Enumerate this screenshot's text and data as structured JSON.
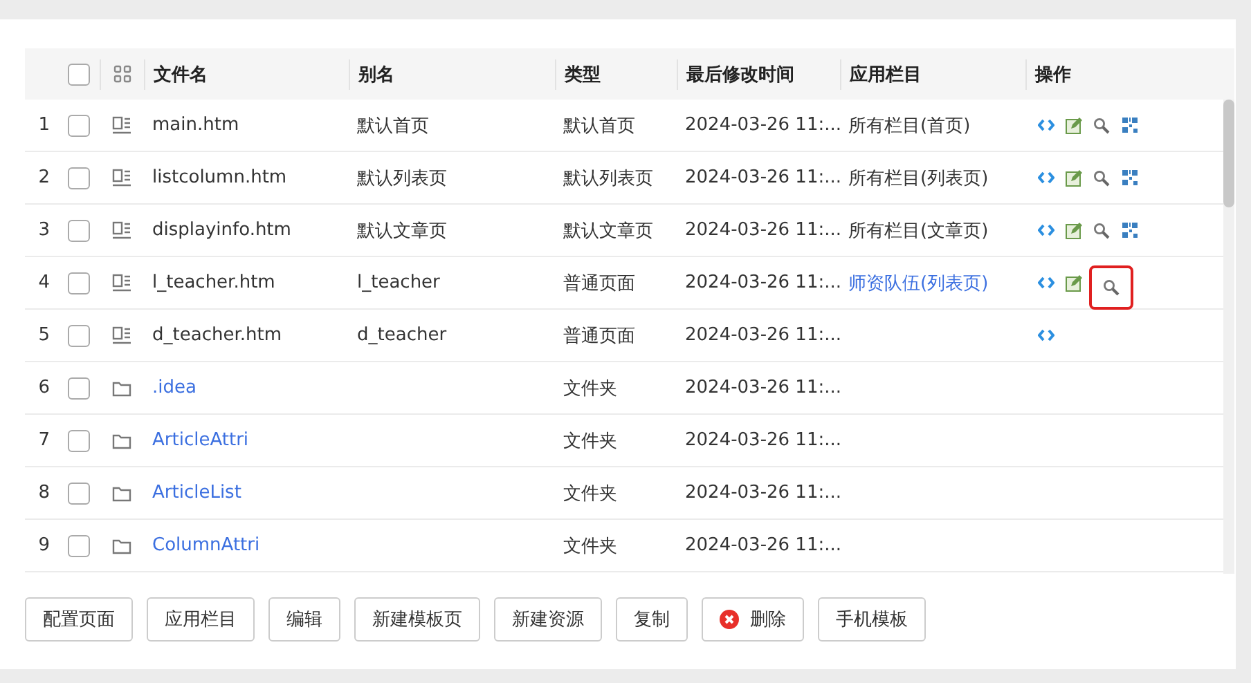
{
  "table": {
    "columns": [
      "文件名",
      "别名",
      "类型",
      "最后修改时间",
      "应用栏目",
      "操作"
    ],
    "all_checked": false,
    "rows": [
      {
        "index": "1",
        "kind": "file",
        "checked": false,
        "name": "main.htm",
        "alias": "默认首页",
        "type": "默认首页",
        "modified": "2024-03-26 11:...",
        "app_column": {
          "text": "所有栏目(首页)",
          "link": false
        },
        "actions": [
          {
            "kind": "source",
            "highlighted": false
          },
          {
            "kind": "edit",
            "highlighted": false
          },
          {
            "kind": "view",
            "highlighted": false
          },
          {
            "kind": "qrcode",
            "highlighted": false
          }
        ]
      },
      {
        "index": "2",
        "kind": "file",
        "checked": false,
        "name": "listcolumn.htm",
        "alias": "默认列表页",
        "type": "默认列表页",
        "modified": "2024-03-26 11:...",
        "app_column": {
          "text": "所有栏目(列表页)",
          "link": false
        },
        "actions": [
          {
            "kind": "source",
            "highlighted": false
          },
          {
            "kind": "edit",
            "highlighted": false
          },
          {
            "kind": "view",
            "highlighted": false
          },
          {
            "kind": "qrcode",
            "highlighted": false
          }
        ]
      },
      {
        "index": "3",
        "kind": "file",
        "checked": false,
        "name": "displayinfo.htm",
        "alias": "默认文章页",
        "type": "默认文章页",
        "modified": "2024-03-26 11:...",
        "app_column": {
          "text": "所有栏目(文章页)",
          "link": false
        },
        "actions": [
          {
            "kind": "source",
            "highlighted": false
          },
          {
            "kind": "edit",
            "highlighted": false
          },
          {
            "kind": "view",
            "highlighted": false
          },
          {
            "kind": "qrcode",
            "highlighted": false
          }
        ]
      },
      {
        "index": "4",
        "kind": "file",
        "checked": false,
        "name": "l_teacher.htm",
        "alias": "l_teacher",
        "type": "普通页面",
        "modified": "2024-03-26 11:...",
        "app_column": {
          "text": "师资队伍(列表页)",
          "link": true
        },
        "actions": [
          {
            "kind": "source",
            "highlighted": false
          },
          {
            "kind": "edit",
            "highlighted": false
          },
          {
            "kind": "view",
            "highlighted": true
          }
        ]
      },
      {
        "index": "5",
        "kind": "file",
        "checked": false,
        "name": "d_teacher.htm",
        "alias": "d_teacher",
        "type": "普通页面",
        "modified": "2024-03-26 11:...",
        "actions": [
          {
            "kind": "source",
            "highlighted": false
          }
        ]
      },
      {
        "index": "6",
        "kind": "folder",
        "checked": false,
        "name": ".idea",
        "type": "文件夹",
        "modified": "2024-03-26 11:..."
      },
      {
        "index": "7",
        "kind": "folder",
        "checked": false,
        "name": "ArticleAttri",
        "type": "文件夹",
        "modified": "2024-03-26 11:..."
      },
      {
        "index": "8",
        "kind": "folder",
        "checked": false,
        "name": "ArticleList",
        "type": "文件夹",
        "modified": "2024-03-26 11:..."
      },
      {
        "index": "9",
        "kind": "folder",
        "checked": false,
        "name": "ColumnAttri",
        "type": "文件夹",
        "modified": "2024-03-26 11:..."
      }
    ]
  },
  "buttons": [
    {
      "label": "配置页面",
      "kind": "plain"
    },
    {
      "label": "应用栏目",
      "kind": "plain"
    },
    {
      "label": "编辑",
      "kind": "plain"
    },
    {
      "label": "新建模板页",
      "kind": "plain"
    },
    {
      "label": "新建资源",
      "kind": "plain"
    },
    {
      "label": "复制",
      "kind": "plain"
    },
    {
      "label": "删除",
      "kind": "delete"
    },
    {
      "label": "手机模板",
      "kind": "plain"
    }
  ]
}
